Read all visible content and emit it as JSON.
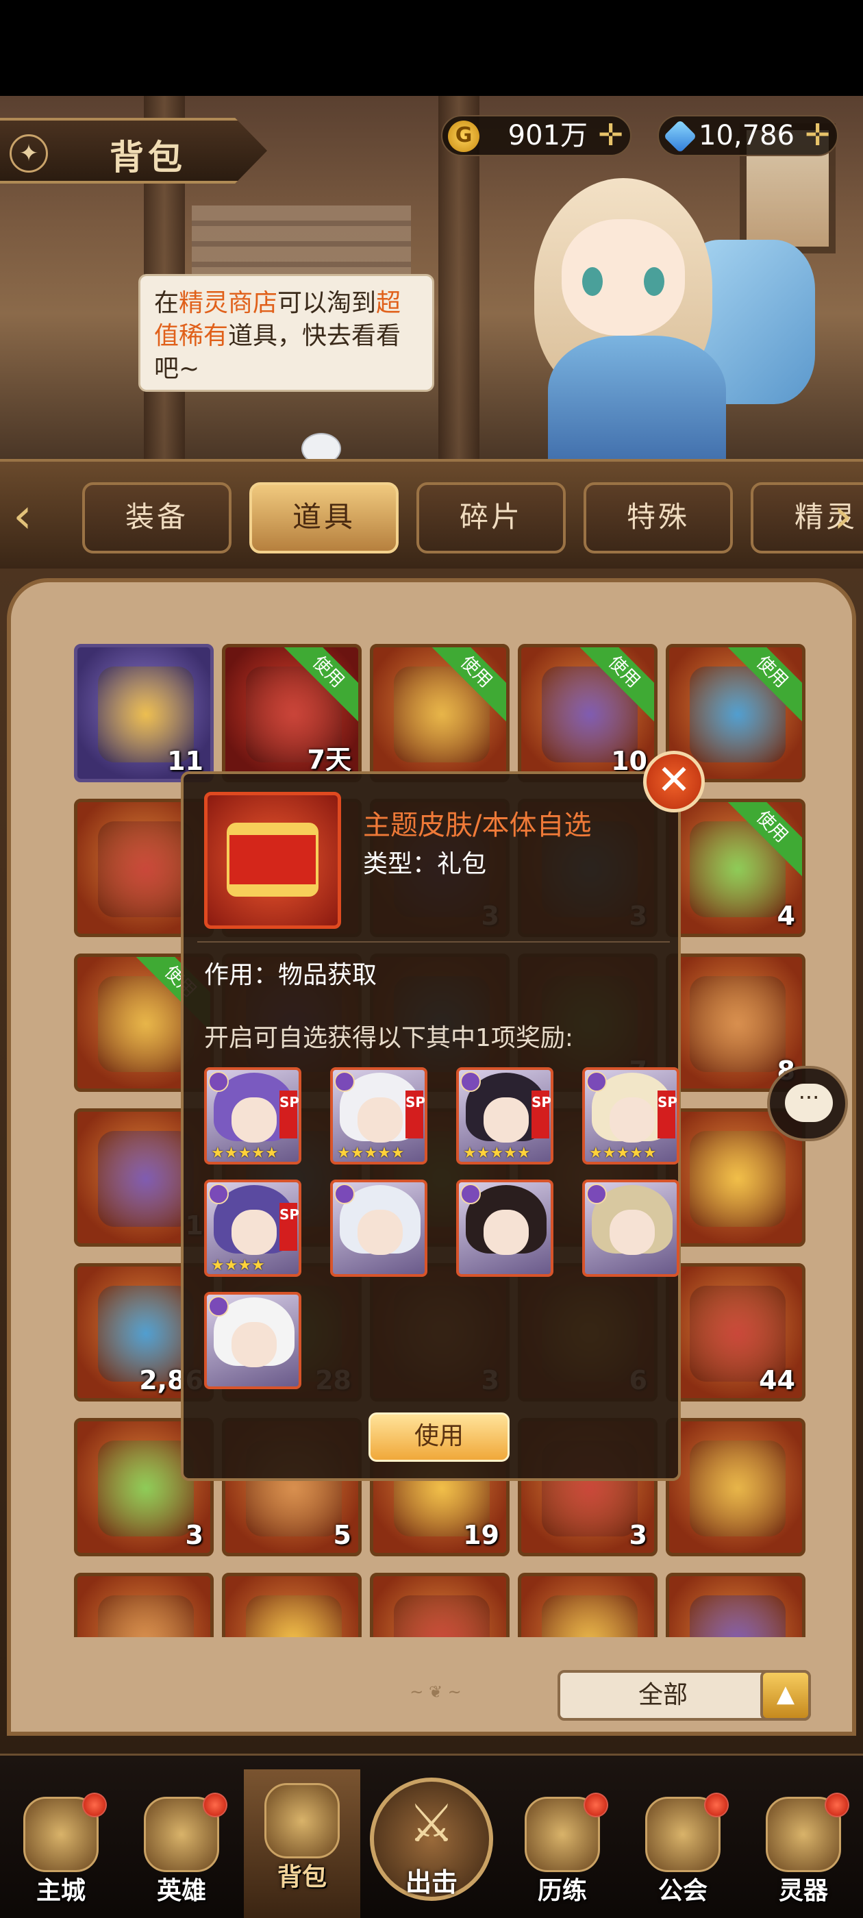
{
  "header": {
    "title": "背包",
    "gold": "901万",
    "gems": "10,786",
    "npc_tip": {
      "p1": "在",
      "hl1": "精灵商店",
      "p2": "可以淘到",
      "hl2": "超值稀有",
      "p3": "道具，快去看看吧~"
    }
  },
  "tabs": [
    {
      "label": "装备",
      "active": false
    },
    {
      "label": "道具",
      "active": true
    },
    {
      "label": "碎片",
      "active": false
    },
    {
      "label": "特殊",
      "active": false
    },
    {
      "label": "精灵",
      "active": false
    }
  ],
  "inventory": {
    "use_badge": "使用",
    "rows": [
      [
        "11",
        "7天",
        "",
        "10",
        ""
      ],
      [
        "",
        "",
        "3",
        "3",
        "4"
      ],
      [
        "",
        "",
        "",
        "7",
        "8"
      ],
      [
        "1",
        "",
        "",
        "",
        ""
      ],
      [
        "2,86",
        "28",
        "3",
        "6",
        "44"
      ],
      [
        "3",
        "5",
        "19",
        "3",
        ""
      ],
      [
        "",
        "",
        "",
        "",
        ""
      ]
    ],
    "filter_label": "全部"
  },
  "modal": {
    "item_name": "主题皮肤/本体自选",
    "item_type": "类型：礼包",
    "effect": "作用：物品获取",
    "description": "开启可自选获得以下其中1项奖励:",
    "use_button": "使用",
    "rewards": [
      {
        "sp": "SP",
        "stars": "★★★★★"
      },
      {
        "sp": "SP",
        "stars": "★★★★★"
      },
      {
        "sp": "SP",
        "stars": "★★★★★"
      },
      {
        "sp": "SP",
        "stars": "★★★★★"
      },
      {
        "sp": "SP",
        "stars": "★★★★"
      },
      {
        "sp": "",
        "stars": ""
      },
      {
        "sp": "",
        "stars": ""
      },
      {
        "sp": "",
        "stars": ""
      },
      {
        "sp": "",
        "stars": ""
      }
    ]
  },
  "nav": [
    {
      "label": "主城"
    },
    {
      "label": "英雄"
    },
    {
      "label": "背包"
    },
    {
      "label": "出击"
    },
    {
      "label": "历练"
    },
    {
      "label": "公会"
    },
    {
      "label": "灵器"
    }
  ],
  "colors": {
    "accent": "#e0601a",
    "use_green": "#3faa34",
    "panel": "#c8a884"
  }
}
